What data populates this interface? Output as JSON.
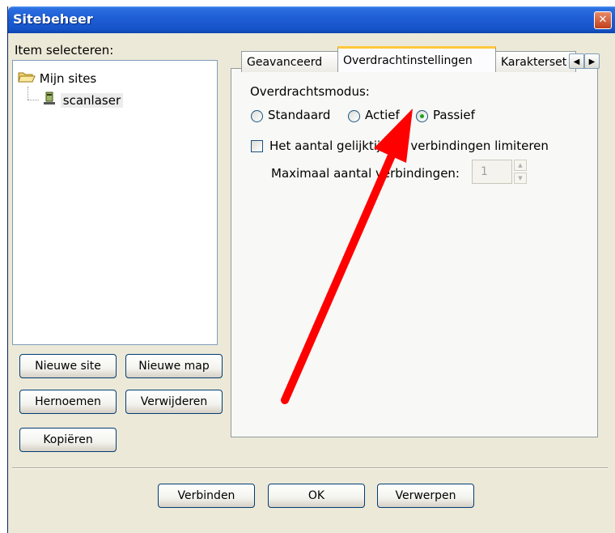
{
  "window": {
    "title": "Sitebeheer"
  },
  "left": {
    "select_label": "Item selecteren:",
    "tree": [
      {
        "label": "Mijn sites",
        "icon": "folder-open-icon"
      },
      {
        "label": "scanlaser",
        "icon": "server-icon"
      }
    ],
    "buttons": {
      "new_site": "Nieuwe site",
      "new_folder": "Nieuwe map",
      "rename": "Hernoemen",
      "delete": "Verwijderen",
      "copy": "Kopiëren"
    }
  },
  "tabs": [
    {
      "label": "Geavanceerd",
      "active": false
    },
    {
      "label": "Overdrachtinstellingen",
      "active": true
    },
    {
      "label": "Karakterset",
      "active": false
    }
  ],
  "transfer": {
    "mode_label": "Overdrachtsmodus:",
    "modes": [
      {
        "label": "Standaard",
        "selected": false
      },
      {
        "label": "Actief",
        "selected": false
      },
      {
        "label": "Passief",
        "selected": true
      }
    ],
    "limit_checkbox_label": "Het aantal gelijktijdige verbindingen limiteren",
    "limit_checked": false,
    "max_connections_label": "Maximaal aantal verbindingen:",
    "max_connections_value": "1"
  },
  "footer": {
    "connect": "Verbinden",
    "ok": "OK",
    "discard": "Verwerpen"
  },
  "colors": {
    "titlebar": "#1f5fd6",
    "annotation_arrow": "#ff0000",
    "active_tab_highlight": "#ffc83c"
  }
}
